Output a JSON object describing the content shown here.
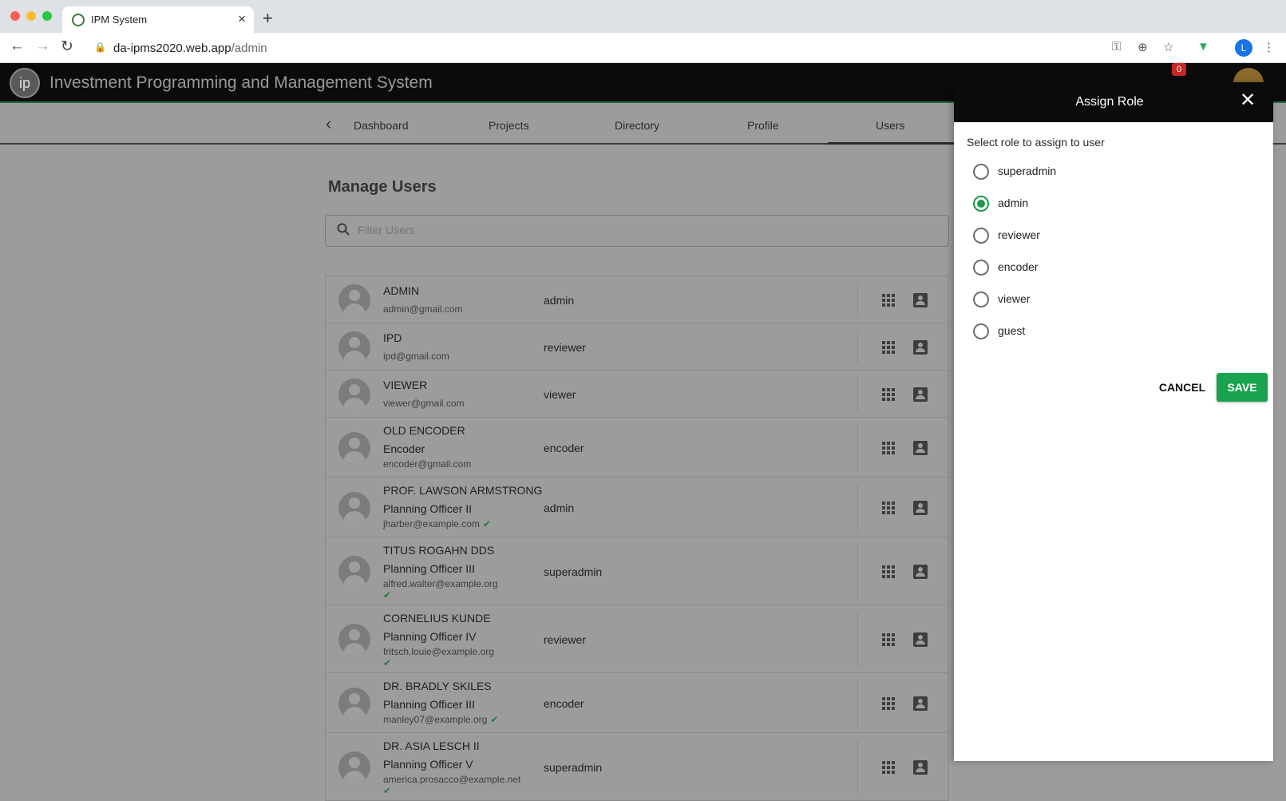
{
  "browser": {
    "tab_title": "IPM System",
    "url_host": "da-ipms2020.web.app",
    "url_path": "/admin",
    "profile_initial": "L"
  },
  "app": {
    "title": "Investment Programming and Management System",
    "cart_count": "0"
  },
  "nav": {
    "tabs": [
      {
        "label": "Dashboard"
      },
      {
        "label": "Projects"
      },
      {
        "label": "Directory"
      },
      {
        "label": "Profile"
      },
      {
        "label": "Users"
      }
    ],
    "active_tab": "Users"
  },
  "main": {
    "title": "Manage Users",
    "filter_placeholder": "Filter Users"
  },
  "users": [
    {
      "name": "ADMIN",
      "position": "",
      "email": "admin@gmail.com",
      "verified": false,
      "role": "admin"
    },
    {
      "name": "IPD",
      "position": "",
      "email": "ipd@gmail.com",
      "verified": false,
      "role": "reviewer"
    },
    {
      "name": "VIEWER",
      "position": "",
      "email": "viewer@gmail.com",
      "verified": false,
      "role": "viewer"
    },
    {
      "name": "OLD ENCODER",
      "position": "Encoder",
      "email": "encoder@gmail.com",
      "verified": false,
      "role": "encoder"
    },
    {
      "name": "PROF. LAWSON ARMSTRONG",
      "position": "Planning Officer II",
      "email": "jharber@example.com",
      "verified": true,
      "role": "admin"
    },
    {
      "name": "TITUS ROGAHN DDS",
      "position": "Planning Officer III",
      "email": "alfred.walter@example.org",
      "verified": true,
      "role": "superadmin"
    },
    {
      "name": "CORNELIUS KUNDE",
      "position": "Planning Officer IV",
      "email": "fritsch.louie@example.org",
      "verified": true,
      "role": "reviewer"
    },
    {
      "name": "DR. BRADLY SKILES",
      "position": "Planning Officer III",
      "email": "manley07@example.org",
      "verified": true,
      "role": "encoder"
    },
    {
      "name": "DR. ASIA LESCH II",
      "position": "Planning Officer V",
      "email": "america.prosacco@example.net",
      "verified": true,
      "role": "superadmin"
    }
  ],
  "dialog": {
    "title": "Assign Role",
    "subtitle": "Select role to assign to user",
    "options": [
      "superadmin",
      "admin",
      "reviewer",
      "encoder",
      "viewer",
      "guest"
    ],
    "selected": "admin",
    "cancel_label": "CANCEL",
    "save_label": "SAVE"
  },
  "colors": {
    "accent": "#1aa34f",
    "header_bg": "#0b0b0b",
    "overlay": "#9c9c9c"
  }
}
